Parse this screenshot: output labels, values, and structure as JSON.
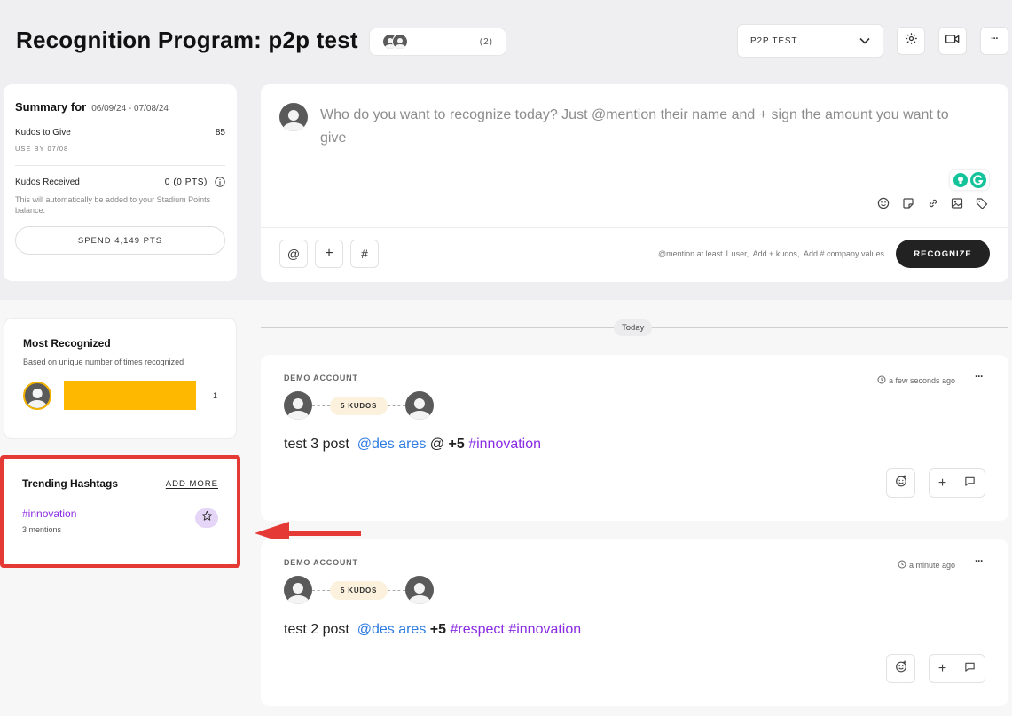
{
  "header": {
    "title": "Recognition Program: p2p test",
    "members_count": "(2)",
    "program_select": "P2P TEST",
    "more_label": "···"
  },
  "summary": {
    "title": "Summary for",
    "date_range": "06/09/24 - 07/08/24",
    "kudos_to_give_label": "Kudos to Give",
    "kudos_to_give_value": "85",
    "use_by": "USE BY 07/08",
    "kudos_received_label": "Kudos Received",
    "kudos_received_value": "0 (0 PTS)",
    "note": "This will automatically be added to your Stadium Points balance.",
    "spend_button": "SPEND 4,149 PTS"
  },
  "composer": {
    "placeholder": "Who do you want to recognize today? Just @mention their name and + sign the amount you want to give",
    "at_button": "@",
    "plus_button": "+",
    "hash_button": "#",
    "hint": "@mention at least 1 user,  Add + kudos,  Add # company values",
    "recognize_button": "RECOGNIZE"
  },
  "most_recognized": {
    "title": "Most Recognized",
    "subtitle": "Based on unique number of times recognized",
    "entries": [
      {
        "count": "1",
        "bar_color": "#ffb800"
      }
    ]
  },
  "trending": {
    "title": "Trending Hashtags",
    "add_more": "ADD MORE",
    "items": [
      {
        "tag": "#innovation",
        "mentions": "3 mentions"
      }
    ]
  },
  "feed": {
    "divider_label": "Today",
    "posts": [
      {
        "author": "DEMO ACCOUNT",
        "time": "a few seconds ago",
        "kudos": "5 KUDOS",
        "text_prefix": "test 3 post",
        "mention": "@des ares",
        "extra": "@",
        "points": "+5",
        "tags": [
          "#innovation"
        ]
      },
      {
        "author": "DEMO ACCOUNT",
        "time": "a minute ago",
        "kudos": "5 KUDOS",
        "text_prefix": "test 2 post",
        "mention": "@des ares",
        "extra": "",
        "points": "+5",
        "tags": [
          "#respect",
          "#innovation"
        ]
      }
    ]
  },
  "colors": {
    "accent_purple": "#8a2be2",
    "mention_blue": "#2d7be0",
    "highlight_red": "#e53935",
    "recognize_dark": "#222222",
    "grammarly_green": "#15c39a"
  }
}
